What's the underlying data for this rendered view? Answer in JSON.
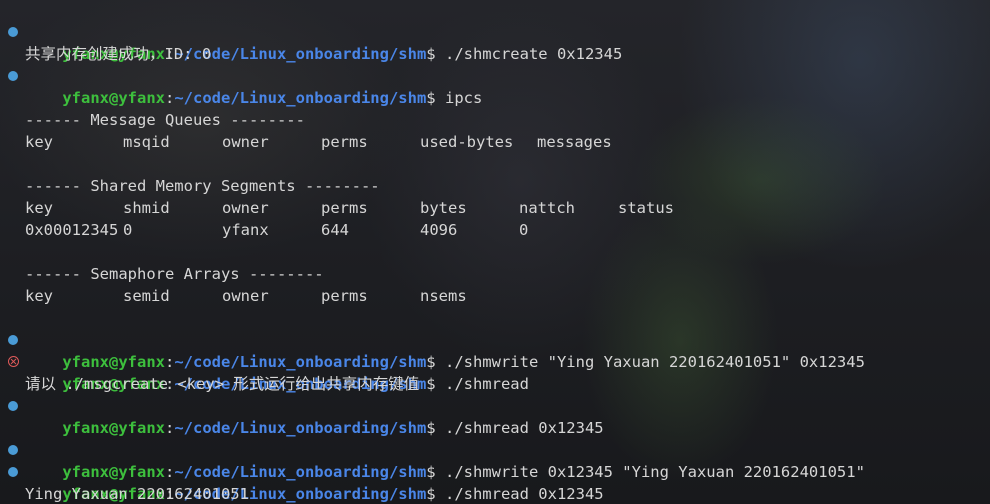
{
  "prompt": {
    "user": "yfanx@yfanx",
    "path": "~/code/Linux_onboarding/shm",
    "symbol": "$",
    "colon": ":"
  },
  "lines": {
    "l1_cmd": "./shmcreate 0x12345",
    "l2_out": "共享内存创建成功，ID: 0",
    "l3_cmd": "ipcs",
    "mq_header": "------ Message Queues --------",
    "mq_cols": [
      "key",
      "msqid",
      "owner",
      "perms",
      "used-bytes",
      "messages"
    ],
    "shm_header": "------ Shared Memory Segments --------",
    "shm_cols": [
      "key",
      "shmid",
      "owner",
      "perms",
      "bytes",
      "nattch",
      "status"
    ],
    "shm_row": [
      "0x00012345",
      "0",
      "yfanx",
      "644",
      "4096",
      "0",
      ""
    ],
    "sem_header": "------ Semaphore Arrays --------",
    "sem_cols": [
      "key",
      "semid",
      "owner",
      "perms",
      "nsems"
    ],
    "l4_cmd": "./shmwrite \"Ying Yaxuan 220162401051\" 0x12345",
    "l5_cmd": "./shmread",
    "l6_out": "请以 ./msgcreate <key> 形式运行给出共享内存键值",
    "l7_cmd": "./shmread 0x12345",
    "l8_cmd": "./shmwrite 0x12345 \"Ying Yaxuan 220162401051\"",
    "l9_cmd": "./shmread 0x12345",
    "l10_out": "Ying Yaxuan 220162401051"
  },
  "status_colors": {
    "success": "#4a9bd6",
    "error": "#e05a5a",
    "user": "#3dbf3d",
    "path": "#4a86e8"
  }
}
